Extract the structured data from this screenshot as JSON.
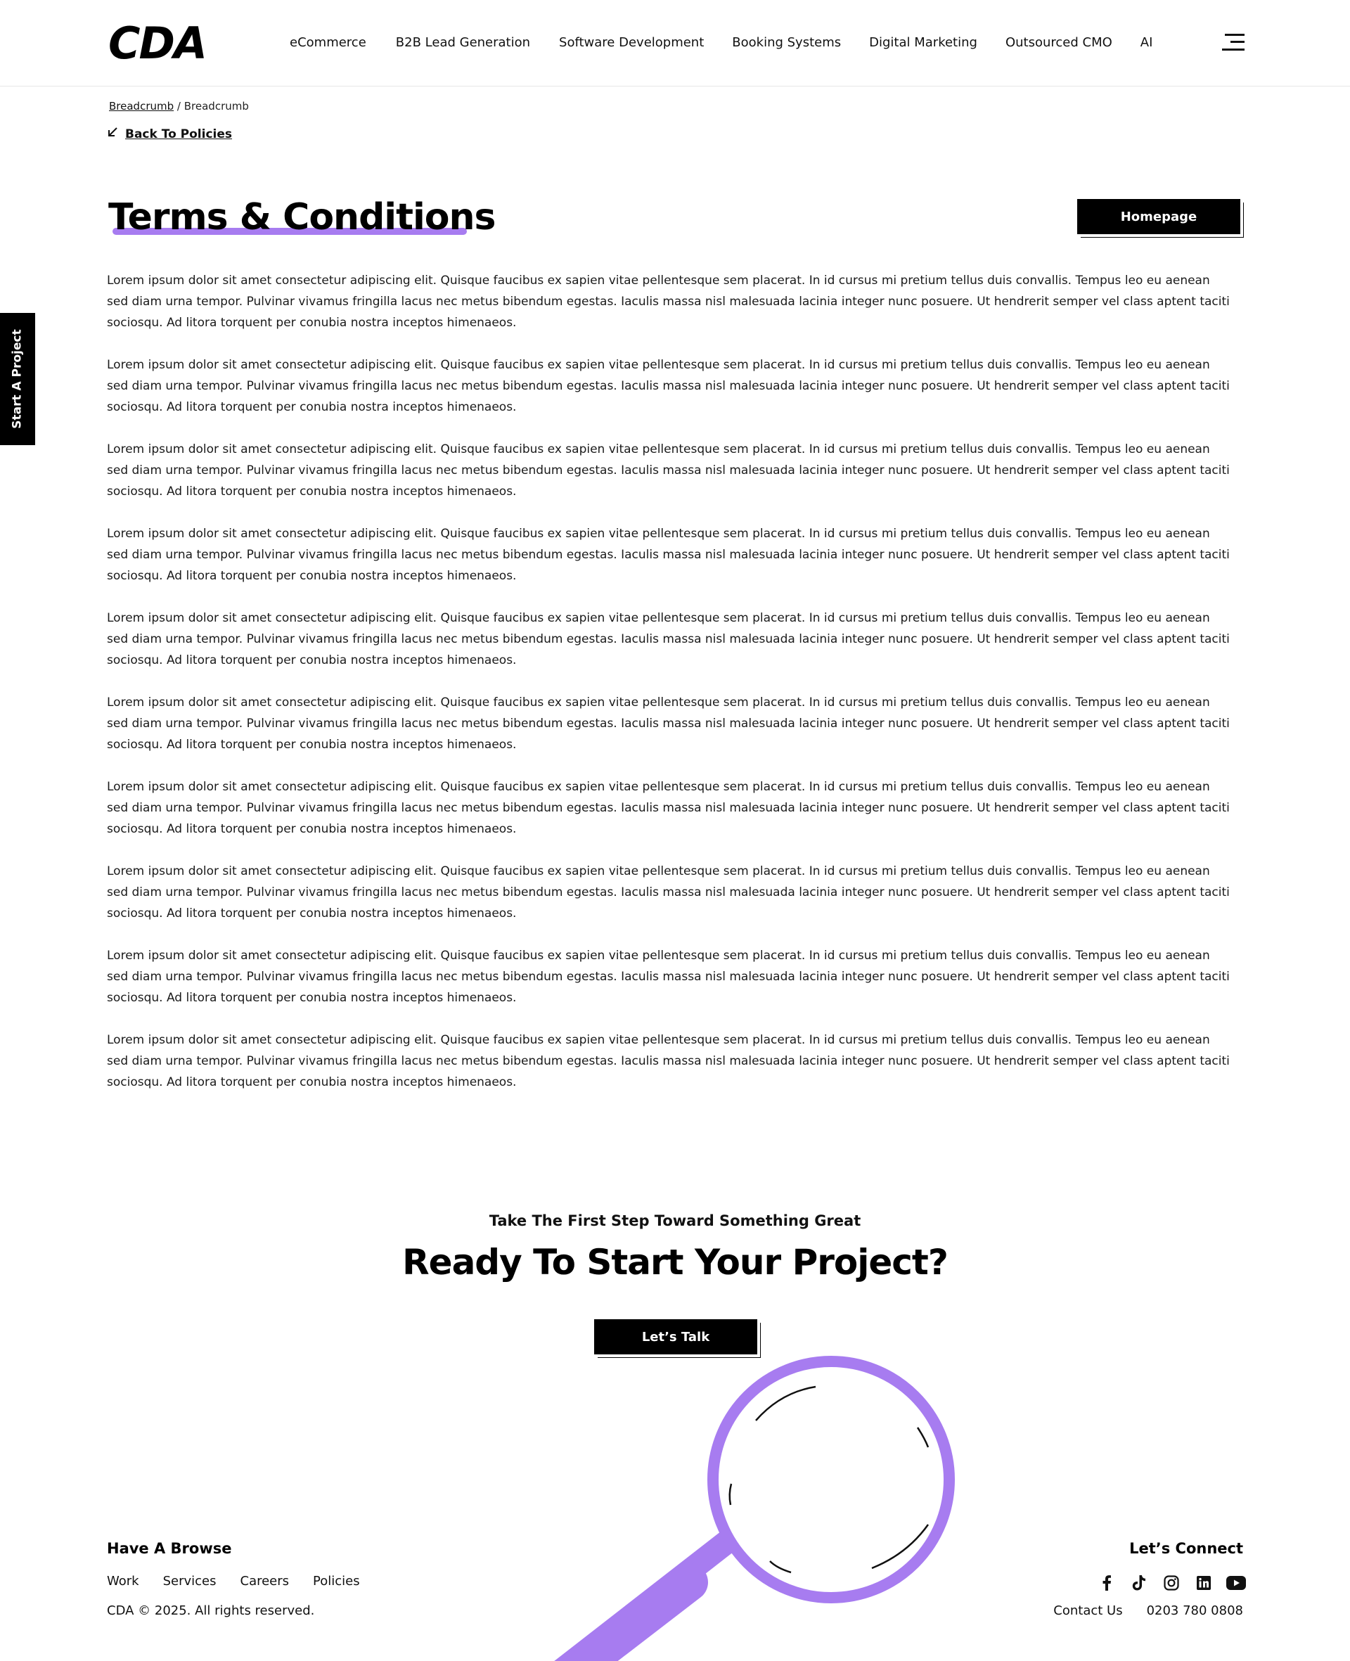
{
  "header": {
    "logo": "CDA",
    "nav": [
      "eCommerce",
      "B2B Lead Generation",
      "Software Development",
      "Booking Systems",
      "Digital Marketing",
      "Outsourced CMO",
      "AI"
    ]
  },
  "breadcrumb": {
    "link": "Breadcrumb",
    "separator": "/",
    "current": "Breadcrumb"
  },
  "back_link": "Back To Policies",
  "page_title": "Terms & Conditions",
  "homepage_button": "Homepage",
  "side_tab": "Start A Project",
  "paragraphs": [
    "Lorem ipsum dolor sit amet consectetur adipiscing elit. Quisque faucibus ex sapien vitae pellentesque sem placerat. In id cursus mi pretium tellus duis convallis. Tempus leo eu aenean sed diam urna tempor. Pulvinar vivamus fringilla lacus nec metus bibendum egestas. Iaculis massa nisl malesuada lacinia integer nunc posuere. Ut hendrerit semper vel class aptent taciti sociosqu. Ad litora torquent per conubia nostra inceptos himenaeos.",
    "Lorem ipsum dolor sit amet consectetur adipiscing elit. Quisque faucibus ex sapien vitae pellentesque sem placerat. In id cursus mi pretium tellus duis convallis. Tempus leo eu aenean sed diam urna tempor. Pulvinar vivamus fringilla lacus nec metus bibendum egestas. Iaculis massa nisl malesuada lacinia integer nunc posuere. Ut hendrerit semper vel class aptent taciti sociosqu. Ad litora torquent per conubia nostra inceptos himenaeos.",
    "Lorem ipsum dolor sit amet consectetur adipiscing elit. Quisque faucibus ex sapien vitae pellentesque sem placerat. In id cursus mi pretium tellus duis convallis. Tempus leo eu aenean sed diam urna tempor. Pulvinar vivamus fringilla lacus nec metus bibendum egestas. Iaculis massa nisl malesuada lacinia integer nunc posuere. Ut hendrerit semper vel class aptent taciti sociosqu. Ad litora torquent per conubia nostra inceptos himenaeos.",
    "Lorem ipsum dolor sit amet consectetur adipiscing elit. Quisque faucibus ex sapien vitae pellentesque sem placerat. In id cursus mi pretium tellus duis convallis. Tempus leo eu aenean sed diam urna tempor. Pulvinar vivamus fringilla lacus nec metus bibendum egestas. Iaculis massa nisl malesuada lacinia integer nunc posuere. Ut hendrerit semper vel class aptent taciti sociosqu. Ad litora torquent per conubia nostra inceptos himenaeos.",
    "Lorem ipsum dolor sit amet consectetur adipiscing elit. Quisque faucibus ex sapien vitae pellentesque sem placerat. In id cursus mi pretium tellus duis convallis. Tempus leo eu aenean sed diam urna tempor. Pulvinar vivamus fringilla lacus nec metus bibendum egestas. Iaculis massa nisl malesuada lacinia integer nunc posuere. Ut hendrerit semper vel class aptent taciti sociosqu. Ad litora torquent per conubia nostra inceptos himenaeos.",
    "Lorem ipsum dolor sit amet consectetur adipiscing elit. Quisque faucibus ex sapien vitae pellentesque sem placerat. In id cursus mi pretium tellus duis convallis. Tempus leo eu aenean sed diam urna tempor. Pulvinar vivamus fringilla lacus nec metus bibendum egestas. Iaculis massa nisl malesuada lacinia integer nunc posuere. Ut hendrerit semper vel class aptent taciti sociosqu. Ad litora torquent per conubia nostra inceptos himenaeos.",
    "Lorem ipsum dolor sit amet consectetur adipiscing elit. Quisque faucibus ex sapien vitae pellentesque sem placerat. In id cursus mi pretium tellus duis convallis. Tempus leo eu aenean sed diam urna tempor. Pulvinar vivamus fringilla lacus nec metus bibendum egestas. Iaculis massa nisl malesuada lacinia integer nunc posuere. Ut hendrerit semper vel class aptent taciti sociosqu. Ad litora torquent per conubia nostra inceptos himenaeos.",
    "Lorem ipsum dolor sit amet consectetur adipiscing elit. Quisque faucibus ex sapien vitae pellentesque sem placerat. In id cursus mi pretium tellus duis convallis. Tempus leo eu aenean sed diam urna tempor. Pulvinar vivamus fringilla lacus nec metus bibendum egestas. Iaculis massa nisl malesuada lacinia integer nunc posuere. Ut hendrerit semper vel class aptent taciti sociosqu. Ad litora torquent per conubia nostra inceptos himenaeos.",
    "Lorem ipsum dolor sit amet consectetur adipiscing elit. Quisque faucibus ex sapien vitae pellentesque sem placerat. In id cursus mi pretium tellus duis convallis. Tempus leo eu aenean sed diam urna tempor. Pulvinar vivamus fringilla lacus nec metus bibendum egestas. Iaculis massa nisl malesuada lacinia integer nunc posuere. Ut hendrerit semper vel class aptent taciti sociosqu. Ad litora torquent per conubia nostra inceptos himenaeos.",
    "Lorem ipsum dolor sit amet consectetur adipiscing elit. Quisque faucibus ex sapien vitae pellentesque sem placerat. In id cursus mi pretium tellus duis convallis. Tempus leo eu aenean sed diam urna tempor. Pulvinar vivamus fringilla lacus nec metus bibendum egestas. Iaculis massa nisl malesuada lacinia integer nunc posuere. Ut hendrerit semper vel class aptent taciti sociosqu. Ad litora torquent per conubia nostra inceptos himenaeos."
  ],
  "cta": {
    "kicker": "Take The First Step Toward Something Great",
    "title_prefix": "Ready To Start Your",
    "title_highlight": "Project?",
    "button": "Let’s Talk"
  },
  "footer": {
    "browse_heading": "Have A Browse",
    "links": [
      "Work",
      "Services",
      "Careers",
      "Policies"
    ],
    "copyright": "CDA © 2025. All rights reserved.",
    "connect_heading": "Let’s Connect",
    "social_icons": [
      "facebook-icon",
      "tiktok-icon",
      "instagram-icon",
      "linkedin-icon",
      "youtube-icon"
    ],
    "contact_label": "Contact Us",
    "phone": "0203 780 0808"
  },
  "colors": {
    "accent_purple": "#a77cf0",
    "accent_orange": "#f5852a",
    "primary": "#000000"
  }
}
